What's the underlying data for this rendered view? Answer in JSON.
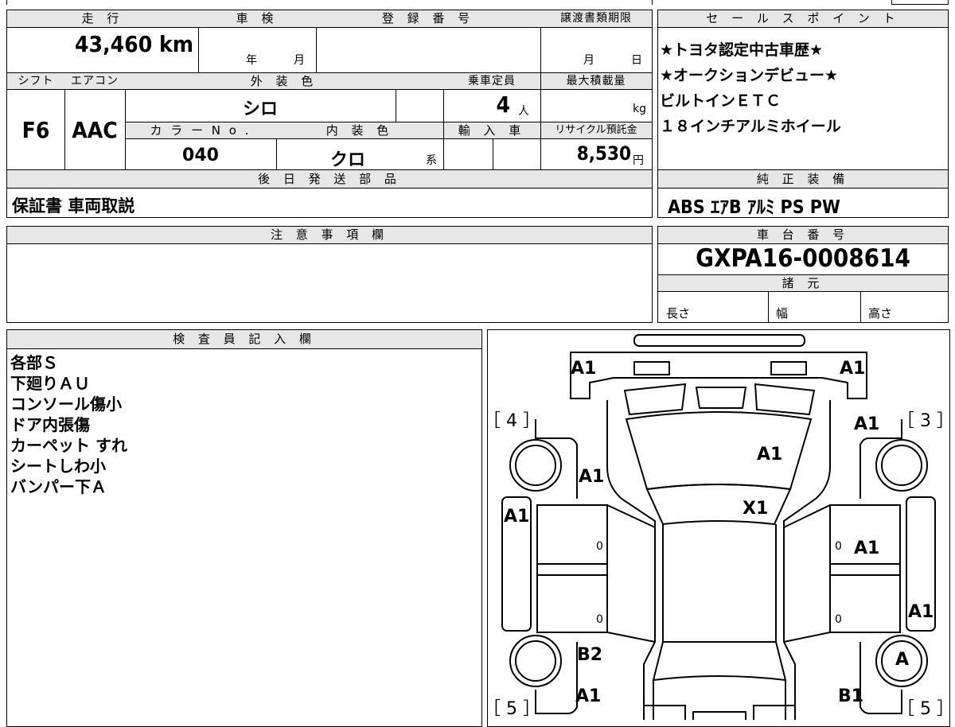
{
  "summary": {
    "mileage_label": "走 行",
    "mileage_value": "43,460 km",
    "shaken_label": "車 検",
    "shaken_year": "年",
    "shaken_month": "月",
    "reg_label": "登 録 番 号",
    "transfer_label": "譲渡書類期限",
    "transfer_month": "月",
    "transfer_day": "日",
    "shift_label": "シフト",
    "shift_value": "F6",
    "ac_label": "エアコン",
    "ac_value": "AAC",
    "ext_color_label": "外 装 色",
    "ext_color_value": "シロ",
    "capacity_label": "乗車定員",
    "capacity_value": "4",
    "capacity_unit": "人",
    "maxload_label": "最大積載量",
    "maxload_unit": "kg",
    "color_no_label": "カ ラ ー N o .",
    "color_no_value": "040",
    "int_color_label": "内 装 色",
    "int_color_value": "クロ",
    "int_color_suffix": "系",
    "import_label": "輸 入 車",
    "recycle_label": "リサイクル預託金",
    "recycle_value": "8,530",
    "recycle_unit": "円",
    "later_parts_label": "後 日 発 送 部 品",
    "later_parts_value": "保証書 車両取説"
  },
  "sales_points": {
    "label": "セ ー ル ス ポ イ ン ト",
    "items": [
      "★トヨタ認定中古車歴★",
      "★オークションデビュー★",
      "ビルトインＥＴＣ",
      "１８インチアルミホイール"
    ]
  },
  "equipment": {
    "label": "純 正 装 備",
    "value": "ABS ｴｱB ｱﾙﾐ PS PW"
  },
  "caution": {
    "label": "注 意 事 項 欄"
  },
  "chassis": {
    "label": "車 台 番 号",
    "value": "GXPA16-0008614",
    "specs_label": "諸 元",
    "length_label": "長さ",
    "width_label": "幅",
    "height_label": "高さ"
  },
  "inspector": {
    "label": "検 査 員 記 入 欄",
    "notes": [
      "各部Ｓ",
      "下廻りＡＵ",
      "コンソール傷小",
      "ドア内張傷",
      "カーペット すれ",
      "シートしわ小",
      "バンパー下Ａ"
    ]
  },
  "diagram": {
    "codes": {
      "front_left": "A1",
      "front_right": "A1",
      "fender_right": "A1",
      "bonnet": "A1",
      "fender_left": "A1",
      "roof": "X1",
      "door_left": "A1",
      "door_right": "A1",
      "quarter_right": "A1",
      "rear_fender_left": "B2",
      "rear_wheel_right": "A",
      "rear_left": "A1",
      "rear_right": "B1"
    },
    "door_zeros": [
      "0",
      "0",
      "0",
      "0"
    ],
    "corners": {
      "front_left": "［ 4 ］",
      "front_right": "［ 3 ］",
      "rear_left": "［ 5 ］",
      "rear_right": "［ 5 ］"
    }
  }
}
